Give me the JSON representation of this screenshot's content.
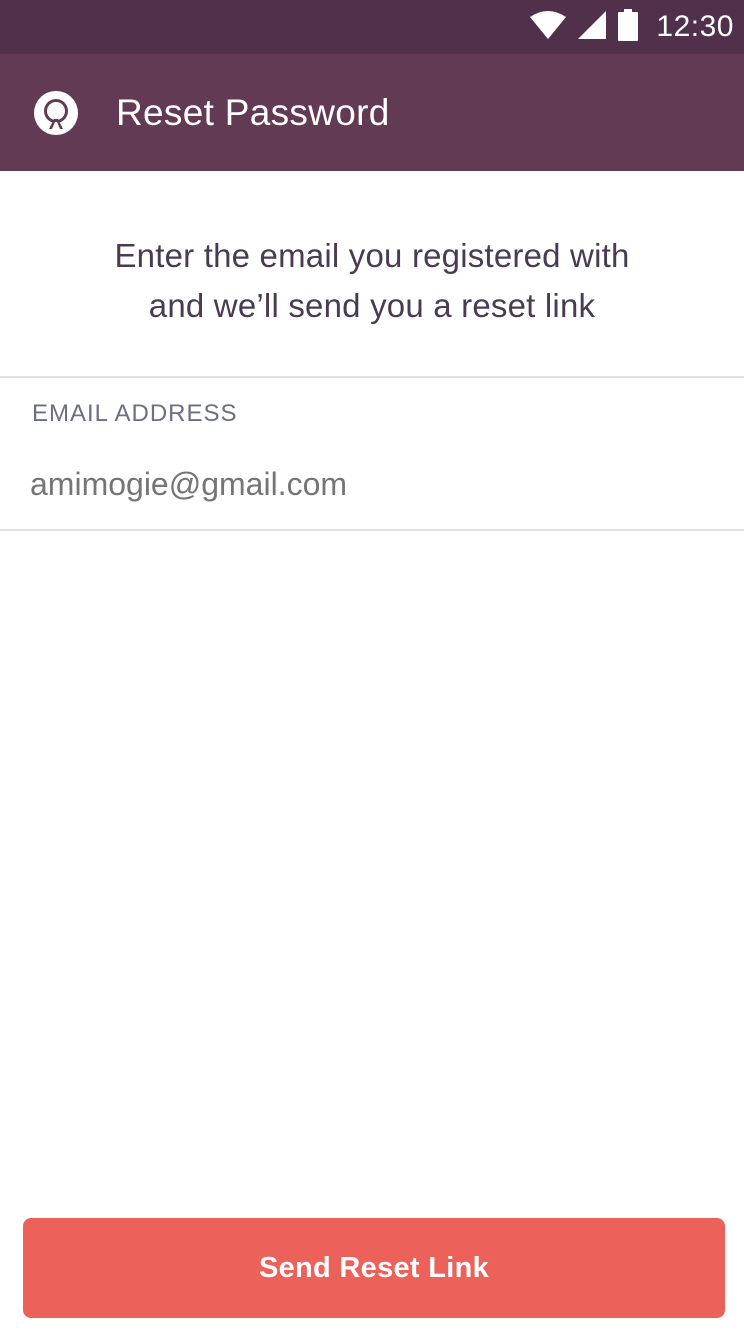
{
  "status_bar": {
    "time": "12:30",
    "icons": [
      "wifi-icon",
      "cellular-signal-icon",
      "battery-icon"
    ],
    "background": "#51304b"
  },
  "app_bar": {
    "title": "Reset Password",
    "logo_icon": "app-logo-icon",
    "background": "#623a54"
  },
  "intro": {
    "line1": "Enter the email you registered with",
    "line2": "and we’ll send you a reset link"
  },
  "email_field": {
    "label": "EMAIL ADDRESS",
    "placeholder": "amimogie@gmail.com",
    "value": ""
  },
  "send_button": {
    "label": "Send Reset Link",
    "color": "#ec6159"
  }
}
